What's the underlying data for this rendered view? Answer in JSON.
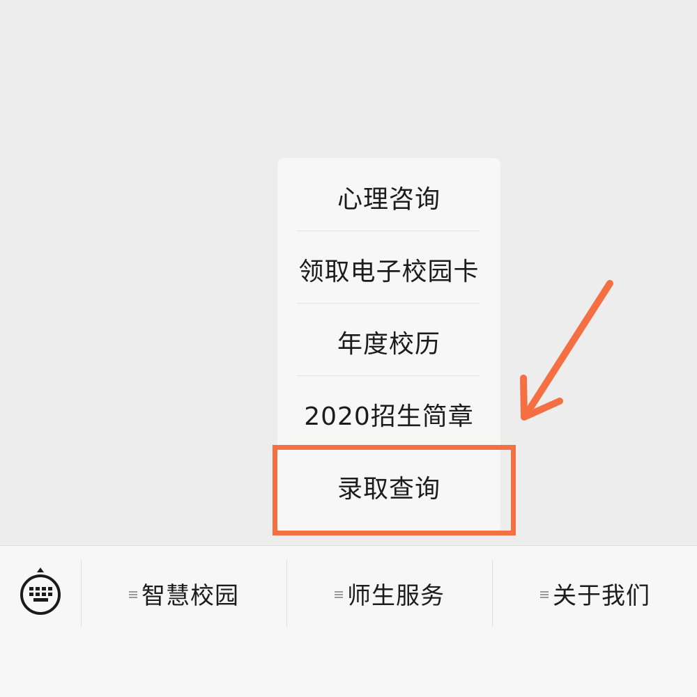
{
  "menu": {
    "items": [
      {
        "label": "心理咨询"
      },
      {
        "label": "领取电子校园卡"
      },
      {
        "label": "年度校历"
      },
      {
        "label": "2020招生简章"
      },
      {
        "label": "录取查询"
      }
    ],
    "highlighted_item": "录取查询"
  },
  "bottom_bar": {
    "keyboard_icon": "keyboard-icon",
    "tabs": [
      {
        "label": "智慧校园",
        "icon": "menu-lines-icon"
      },
      {
        "label": "师生服务",
        "icon": "menu-lines-icon"
      },
      {
        "label": "关于我们",
        "icon": "menu-lines-icon"
      }
    ]
  },
  "colors": {
    "annotation": "#f47042",
    "background": "#ededed",
    "menu_background": "#f7f7f7"
  }
}
